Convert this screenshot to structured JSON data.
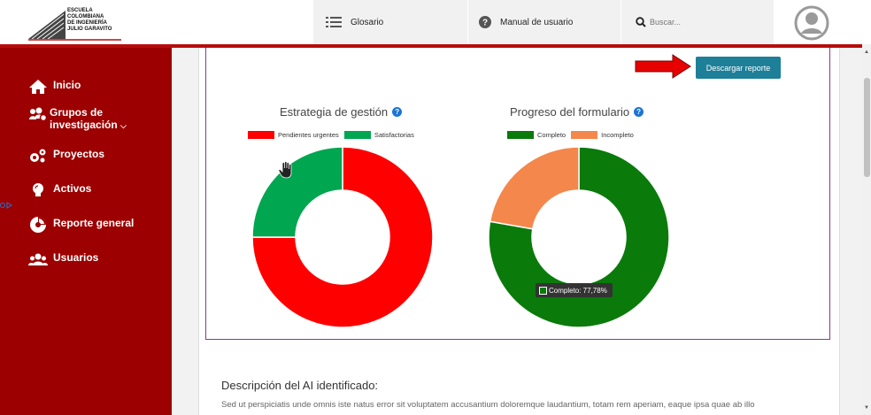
{
  "logo": {
    "lines": [
      "Escuela",
      "Colombiana",
      "de Ingeniería",
      "Julio Garavito"
    ]
  },
  "header": {
    "glosario_label": "Glosario",
    "manual_label": "Manual de usuario",
    "search_placeholder": "Buscar..."
  },
  "sidebar": {
    "items": [
      {
        "label": "Inicio",
        "icon": "home-icon"
      },
      {
        "label": "Grupos de investigación",
        "icon": "users-cog-icon"
      },
      {
        "label": "Proyectos",
        "icon": "cogs-icon"
      },
      {
        "label": "Activos",
        "icon": "lightbulb-icon"
      },
      {
        "label": "Reporte general",
        "icon": "chart-pie-icon"
      },
      {
        "label": "Usuarios",
        "icon": "users-icon"
      }
    ]
  },
  "main": {
    "download_label": "Descargar reporte",
    "desc_title": "Descripción del AI identificado:",
    "desc_text": "Sed ut perspiciatis unde omnis iste natus error sit voluptatem accusantium doloremque laudantium, totam rem aperiam, eaque ipsa quae ab illo"
  },
  "chart_data": [
    {
      "type": "pie",
      "title": "Estrategia de gestión",
      "categories": [
        "Pendientes urgentes",
        "Satisfactorias"
      ],
      "values": [
        75,
        25
      ],
      "colors": [
        "#ff0000",
        "#00a650"
      ],
      "legend": "top"
    },
    {
      "type": "pie",
      "title": "Progreso del formulario",
      "categories": [
        "Completo",
        "Incompleto"
      ],
      "values": [
        77.78,
        22.22
      ],
      "colors": [
        "#0a7a0a",
        "#f4874b"
      ],
      "legend": "top",
      "tooltip": "Completo: 77,78%"
    }
  ],
  "colors": {
    "brand_red": "#9c0000",
    "accent_line": "#b70c0c",
    "button": "#1e7f99"
  }
}
